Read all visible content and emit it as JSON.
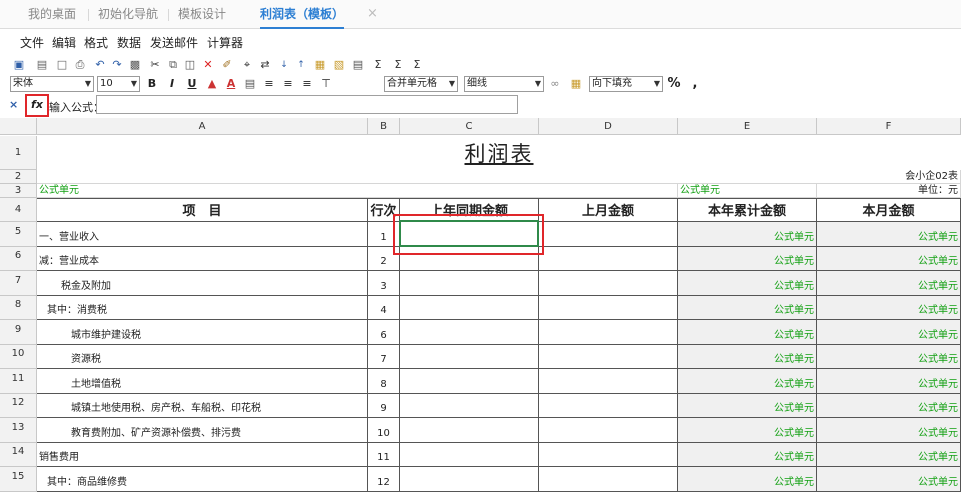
{
  "tabs": [
    {
      "label": "我的桌面"
    },
    {
      "label": "初始化导航"
    },
    {
      "label": "模板设计"
    },
    {
      "label": "利润表（模板）"
    }
  ],
  "tab_close": "×",
  "menu": [
    "文件",
    "编辑",
    "格式",
    "数据",
    "发送邮件",
    "计算器"
  ],
  "toolbar": {
    "font": "宋体",
    "font_size": "10",
    "merge": "合并单元格",
    "border": "细线",
    "fill": "向下填充",
    "percent": "%",
    "comma": ","
  },
  "formula_bar": {
    "cancel": "×",
    "fx": "fx",
    "label": "输入公式：",
    "value": ""
  },
  "columns": [
    "A",
    "B",
    "C",
    "D",
    "E",
    "F"
  ],
  "sheet": {
    "title": "利润表",
    "form_no": "会小企02表",
    "unit": "单位：元",
    "formula_unit": "公式单元",
    "headers": [
      "项　目",
      "行次",
      "上年同期金额",
      "上月金额",
      "本年累计金额",
      "本月金额"
    ],
    "rows": [
      {
        "no": "5",
        "item": "一、营业收入",
        "line": "1"
      },
      {
        "no": "6",
        "item": "减：营业成本",
        "line": "2"
      },
      {
        "no": "7",
        "item": "税金及附加",
        "line": "3"
      },
      {
        "no": "8",
        "item": "其中：消费税",
        "line": "4"
      },
      {
        "no": "9",
        "item": "城市维护建设税",
        "line": "6"
      },
      {
        "no": "10",
        "item": "资源税",
        "line": "7"
      },
      {
        "no": "11",
        "item": "土地增值税",
        "line": "8"
      },
      {
        "no": "12",
        "item": "城镇土地使用税、房产税、车船税、印花税",
        "line": "9"
      },
      {
        "no": "13",
        "item": "教育费附加、矿产资源补偿费、排污费",
        "line": "10"
      },
      {
        "no": "14",
        "item": "销售费用",
        "line": "11"
      },
      {
        "no": "15",
        "item": "其中：商品维修费",
        "line": "12"
      }
    ],
    "row_numbers_top": [
      "1",
      "2",
      "3",
      "4"
    ]
  },
  "colors": {
    "accent": "#2d7fd3",
    "formula_green": "#12a012",
    "highlight_red": "#e0262a"
  }
}
